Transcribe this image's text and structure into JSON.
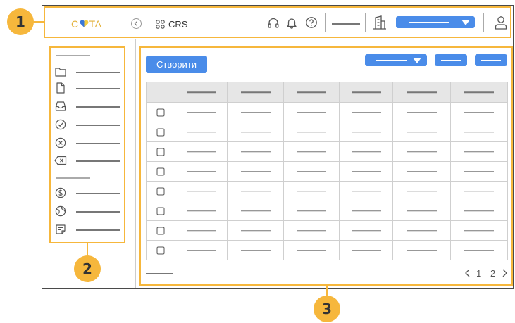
{
  "annotations": {
    "badge_1": "1",
    "badge_2": "2",
    "badge_3": "3",
    "highlight_color": "#f6b73c"
  },
  "header": {
    "logo": {
      "text_before": "C",
      "heart_icon": "heart-icon",
      "text_after": "TA",
      "color": "#e3b23c",
      "heart_blue": "#3a78d8",
      "heart_yellow": "#f4cc3f"
    },
    "collapse_icon": "chevron-left-icon",
    "app_switcher_icon": "grid-icon",
    "app_name": "CRS",
    "support_icon": "headset-icon",
    "notifications_icon": "bell-icon",
    "help_icon": "question-circle-icon",
    "org_icon": "building-icon",
    "org_dropdown_icon": "caret-down-icon",
    "user_icon": "user-icon"
  },
  "sidebar": {
    "items": [
      {
        "icon": "folder-icon"
      },
      {
        "icon": "document-icon"
      },
      {
        "icon": "inbox-icon"
      },
      {
        "icon": "check-circle-icon"
      },
      {
        "icon": "x-circle-icon"
      },
      {
        "icon": "x-tag-icon"
      },
      {
        "icon": "dollar-circle-icon"
      },
      {
        "icon": "globe-icon"
      },
      {
        "icon": "note-icon"
      }
    ]
  },
  "main": {
    "create_button": "Створити",
    "filter_dropdown_icon": "caret-down-icon",
    "table": {
      "columns": 7,
      "rows": 8
    },
    "pagination": {
      "prev_icon": "chevron-left-icon",
      "pages": [
        "1",
        "2"
      ],
      "next_icon": "chevron-right-icon"
    }
  },
  "colors": {
    "primary": "#4a8ce9",
    "table_header": "#e6e6e6",
    "frame_border": "#4a4a4a"
  }
}
